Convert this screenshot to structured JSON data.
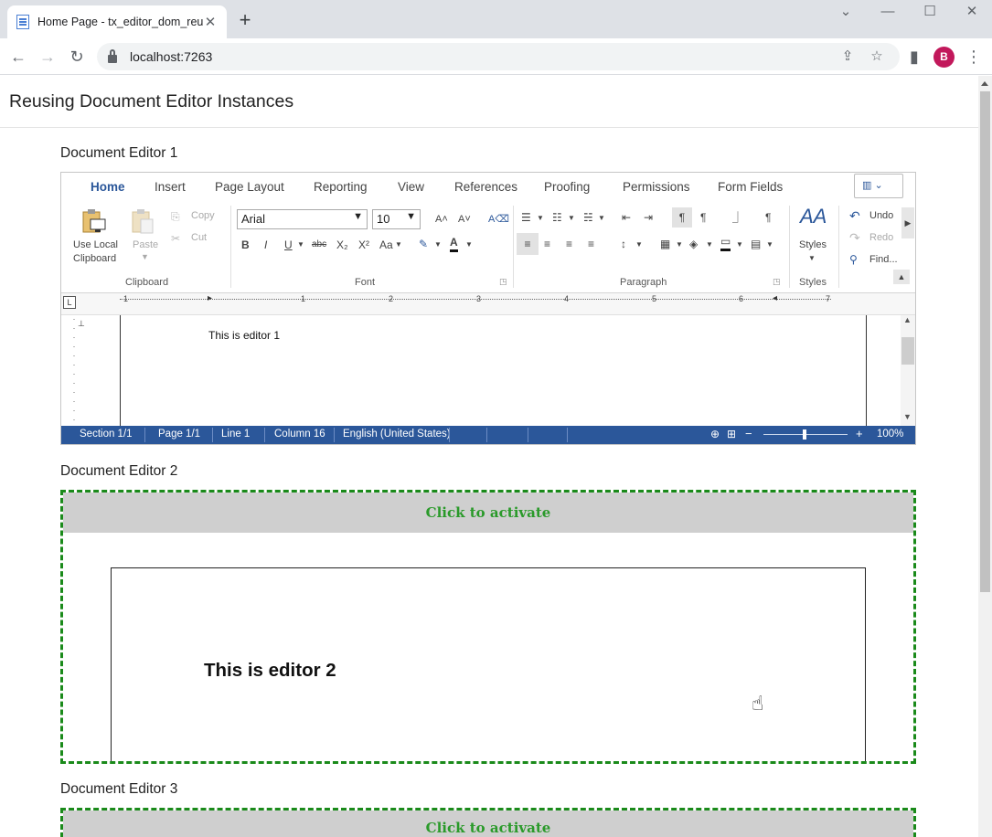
{
  "browser": {
    "tab_title": "Home Page - tx_editor_dom_reu",
    "close_glyph": "✕",
    "new_tab_glyph": "+",
    "url": "localhost:7263",
    "avatar_letter": "B",
    "icons": {
      "back": "←",
      "forward": "→",
      "reload": "↻",
      "share": "⇪",
      "star": "☆",
      "sidebar": "▮",
      "menu": "⋮",
      "tab_search": "⌄",
      "minimize": "—",
      "maximize": "☐",
      "close": "✕"
    }
  },
  "page": {
    "title": "Reusing Document Editor Instances"
  },
  "editor1": {
    "label": "Document Editor 1",
    "tabs": [
      "Home",
      "Insert",
      "Page Layout",
      "Reporting",
      "View",
      "References",
      "Proofing",
      "Permissions",
      "Form Fields"
    ],
    "clipboard": {
      "use_local_1": "Use Local",
      "use_local_2": "Clipboard",
      "paste": "Paste",
      "copy": "Copy",
      "cut": "Cut",
      "group_label": "Clipboard"
    },
    "font": {
      "name": "Arial",
      "size": "10",
      "group_label": "Font",
      "grow": "A˄",
      "shrink": "A˅",
      "clear": "A⌫",
      "bold": "B",
      "italic": "I",
      "underline": "U",
      "strike": "abc",
      "sub": "X₂",
      "sup": "X²",
      "case": "Aa",
      "highlight": "✎",
      "color": "A"
    },
    "paragraph": {
      "group_label": "Paragraph",
      "bullets": "☰",
      "numbering": "☷",
      "multilevel": "☵",
      "outdent": "⇤",
      "indent": "⇥",
      "ltr": "¶",
      "rtl": "¶",
      "pagebreak": "⏌",
      "show_marks": "¶",
      "align_left": "≡",
      "align_center": "≡",
      "align_right": "≡",
      "justify": "≡",
      "spacing": "↕",
      "borders": "▦",
      "shading": "◈",
      "frame": "▭",
      "tabs": "▤"
    },
    "styles": {
      "icon": "AA",
      "label": "Styles",
      "group_label": "Styles"
    },
    "editing": {
      "undo": "Undo",
      "redo": "Redo",
      "find": "Find..."
    },
    "ruler_numbers": [
      "1",
      "1",
      "2",
      "3",
      "4",
      "5",
      "6",
      "7"
    ],
    "content": "This is editor 1",
    "status": {
      "section": "Section 1/1",
      "page": "Page 1/1",
      "line": "Line 1",
      "column": "Column 16",
      "language": "English (United States)",
      "zoom": "100%",
      "zoom_minus": "−",
      "zoom_plus": "+"
    }
  },
  "editor2": {
    "label": "Document Editor 2",
    "activate": "Click to activate",
    "content": "This is editor 2"
  },
  "editor3": {
    "label": "Document Editor 3",
    "activate": "Click to activate"
  },
  "colors": {
    "accent": "#2b579a",
    "activate_border": "#1a8a1a",
    "activate_text": "#2a9a2a",
    "activate_bg": "#cfcfcf",
    "avatar": "#c2185b"
  }
}
